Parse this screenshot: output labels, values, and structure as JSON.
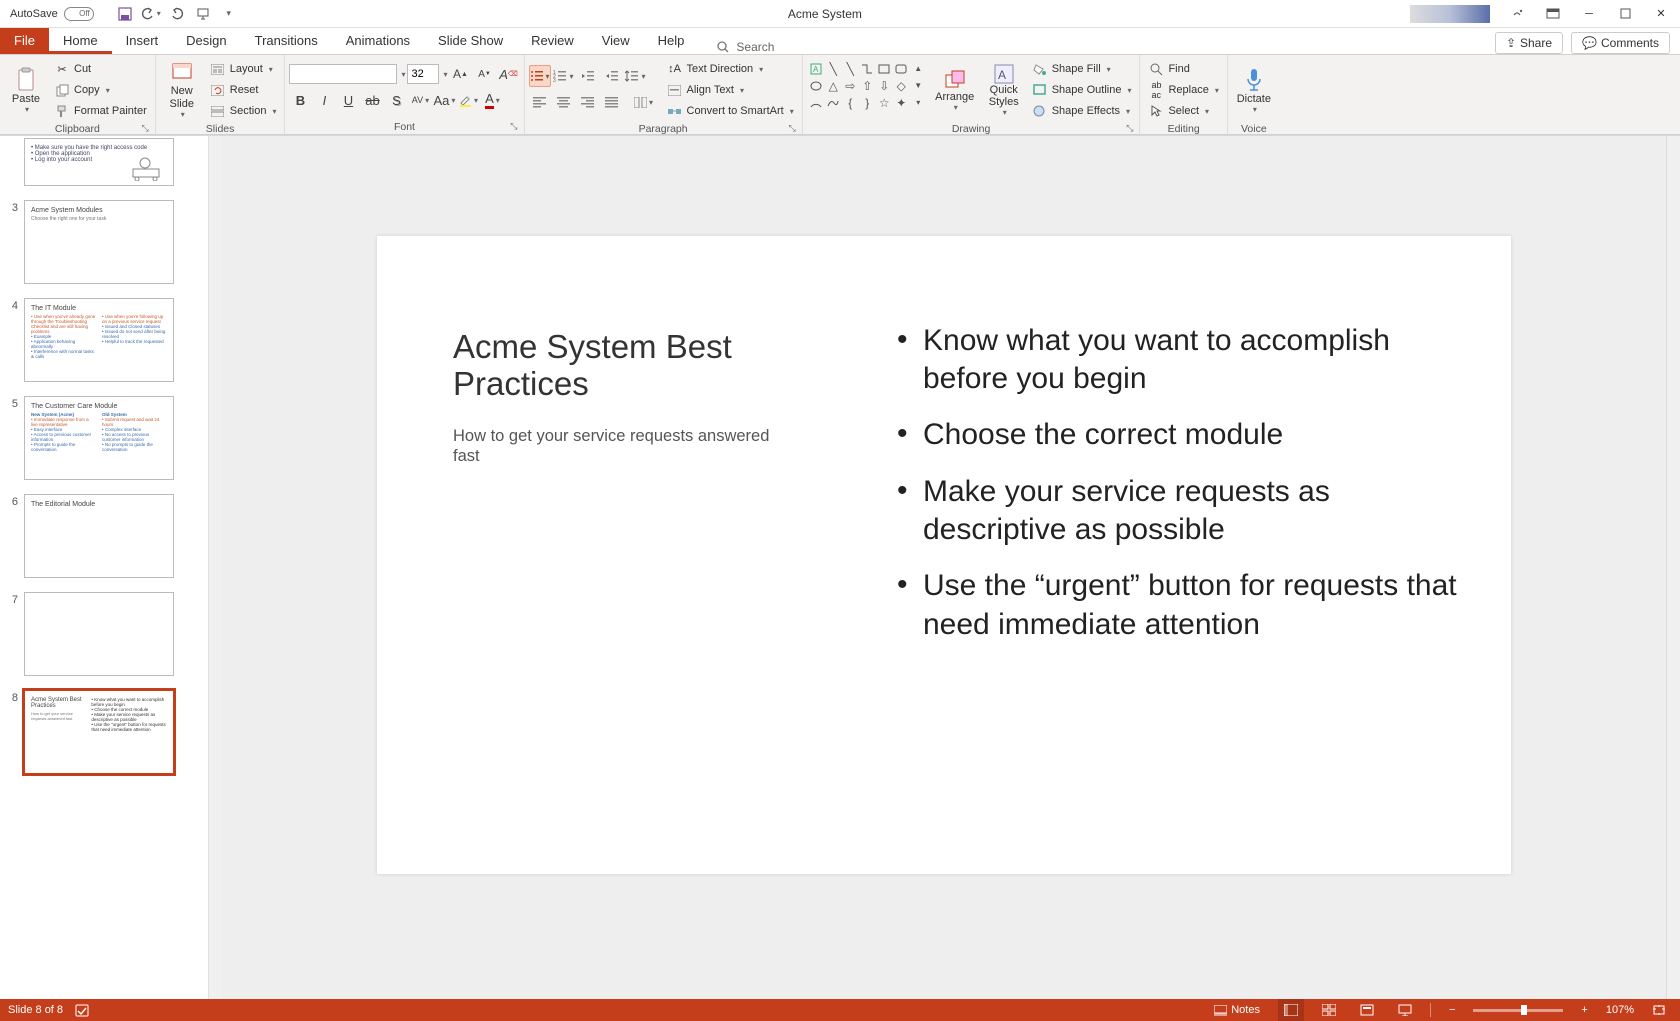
{
  "titlebar": {
    "autosave_label": "AutoSave",
    "autosave_state": "Off",
    "doc_title": "Acme System"
  },
  "tabs": {
    "file": "File",
    "list": [
      "Home",
      "Insert",
      "Design",
      "Transitions",
      "Animations",
      "Slide Show",
      "Review",
      "View",
      "Help"
    ],
    "active_index": 0,
    "search_placeholder": "Search",
    "share": "Share",
    "comments": "Comments"
  },
  "ribbon": {
    "clipboard": {
      "label": "Clipboard",
      "paste": "Paste",
      "cut": "Cut",
      "copy": "Copy",
      "format_painter": "Format Painter"
    },
    "slides": {
      "label": "Slides",
      "new_slide": "New\nSlide",
      "layout": "Layout",
      "reset": "Reset",
      "section": "Section"
    },
    "font": {
      "label": "Font",
      "font_name": "",
      "font_size": "32"
    },
    "paragraph": {
      "label": "Paragraph",
      "text_direction": "Text Direction",
      "align_text": "Align Text",
      "convert_smartart": "Convert to SmartArt"
    },
    "drawing": {
      "label": "Drawing",
      "arrange": "Arrange",
      "quick_styles": "Quick\nStyles",
      "shape_fill": "Shape Fill",
      "shape_outline": "Shape Outline",
      "shape_effects": "Shape Effects"
    },
    "editing": {
      "label": "Editing",
      "find": "Find",
      "replace": "Replace",
      "select": "Select"
    },
    "voice": {
      "label": "Voice",
      "dictate": "Dictate"
    }
  },
  "thumbs": [
    {
      "num": "",
      "title": "",
      "bullets": [
        "• Make sure you have the right access code",
        "• Open the application",
        "• Log into your account"
      ],
      "cut": true
    },
    {
      "num": "3",
      "title": "Acme System Modules",
      "sub": "Choose the right one for your task"
    },
    {
      "num": "4",
      "title": "The IT Module",
      "twocol": {
        "left": [
          "• Use when you've already gone through the Troubleshooting Checklist and are still having problems",
          "• Example",
          "• Application behaving abnormally",
          "• Interference with normal tasks & calls"
        ],
        "right": [
          "• Use when you're following up on a previous service request",
          "• Issued and Closed statuses",
          "• Issued do not send after being resolved",
          "• Helpful to track the requested"
        ]
      }
    },
    {
      "num": "5",
      "title": "The Customer Care Module",
      "twocol": {
        "left_h": "New System (Acme)",
        "right_h": "Old System",
        "left": [
          "• Immediate response from a live representative",
          "• Easy interface",
          "• Access to previous customer information",
          "• Prompts to guide the conversation"
        ],
        "right": [
          "• Submit request and wait 24 hours",
          "• Complex interface",
          "• No access to previous customer information",
          "• No prompts to guide the conversation"
        ]
      }
    },
    {
      "num": "6",
      "title": "The Editorial Module"
    },
    {
      "num": "7",
      "title": ""
    },
    {
      "num": "8",
      "title": "Acme System Best Practices",
      "sub": "How to get your service requests answered fast",
      "selected": true,
      "right": [
        "• Know what you want to accomplish before you begin",
        "• Choose the correct module",
        "• Make your service requests as descriptive as possible",
        "• Use the \"urgent\" button for requests that need immediate attention"
      ]
    }
  ],
  "slide": {
    "title": "Acme System Best Practices",
    "subtitle": "How to get your service requests answered fast",
    "bullets": [
      "Know what you want to accomplish before you begin",
      "Choose the correct module",
      "Make your service requests as descriptive as possible",
      "Use the “urgent” button for requests that need immediate attention"
    ]
  },
  "statusbar": {
    "slide_info": "Slide 8 of 8",
    "notes": "Notes",
    "zoom": "107%"
  }
}
